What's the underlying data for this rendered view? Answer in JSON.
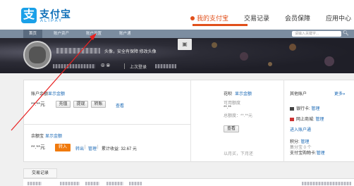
{
  "logo": {
    "mark": "支",
    "cn": "支付宝",
    "en": "ALIPAY"
  },
  "topnav": {
    "items": [
      "我的支付宝",
      "交易记录",
      "会员保障",
      "应用中心"
    ]
  },
  "subnav": {
    "tabs": [
      "首页",
      "账户资产",
      "账户设置",
      "账户通"
    ],
    "search_placeholder": "请输入关键字..."
  },
  "banner": {
    "headpic_tip": "头像，安全有保障 修改头像",
    "last_login": "上次登录"
  },
  "balance": {
    "label": "账户余额",
    "show_amount": "显示金额",
    "amount": "**.**元",
    "buttons": [
      "充值",
      "提现",
      "转账"
    ],
    "query": "查看"
  },
  "yuebao": {
    "label": "余额宝",
    "show_amount": "显示金额",
    "amount": "**.**元",
    "transfer_in": "转入",
    "transfer_out": "转出",
    "manage": "管理",
    "income": "累计收益: 32.67 元"
  },
  "huabei": {
    "label": "花呗",
    "show_amount": "显示金额",
    "available": "可用额度",
    "available_val": "**.**",
    "total": "总额度：**.**元",
    "view_btn": "查看",
    "footer": "以月买，下月还"
  },
  "other_accounts": {
    "label": "其他账户",
    "more": "更多»",
    "bank_card": "银行卡:",
    "bank_manage": "管理",
    "shop": "网上商城:",
    "shop_manage": "管理",
    "enter_account": "进入账户通",
    "points": "积分:",
    "points_manage": "管理",
    "points_val": "集分宝 0 个",
    "alipay_card": "支付宝购物卡:",
    "alipay_manage": "管理"
  },
  "transactions": {
    "tab": "交易记录"
  },
  "colors": {
    "accent": "#e1501b",
    "link": "#1a68b5",
    "orange_btn": "#f07a0d",
    "subnav": "#7c8da0"
  }
}
